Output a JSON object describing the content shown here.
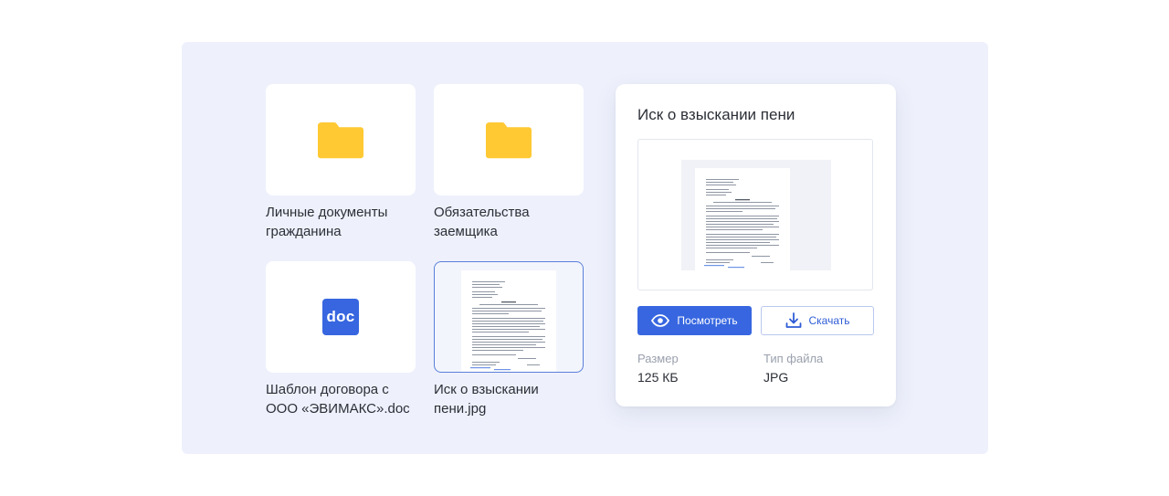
{
  "tiles": [
    {
      "label": "Личные документы гражданина",
      "icon": "folder-icon"
    },
    {
      "label": "Обязательства заемщика",
      "icon": "folder-icon"
    },
    {
      "label": "Шаблон договора с ООО «ЭВИМАКС».doc",
      "icon": "doc-icon",
      "badge": "doc"
    },
    {
      "label": "Иск о взыскании пени.jpg",
      "icon": "document-thumbnail",
      "selected": true
    }
  ],
  "details": {
    "title": "Иск о взыскании пени",
    "view_button": "Посмотреть",
    "download_button": "Скачать",
    "size_label": "Размер",
    "size_value": "125 КБ",
    "type_label": "Тип файла",
    "type_value": "JPG"
  },
  "colors": {
    "panel_bg": "#eef1fc",
    "accent": "#3766e0",
    "folder": "#ffc933",
    "selected_border": "#5b7fd9"
  }
}
